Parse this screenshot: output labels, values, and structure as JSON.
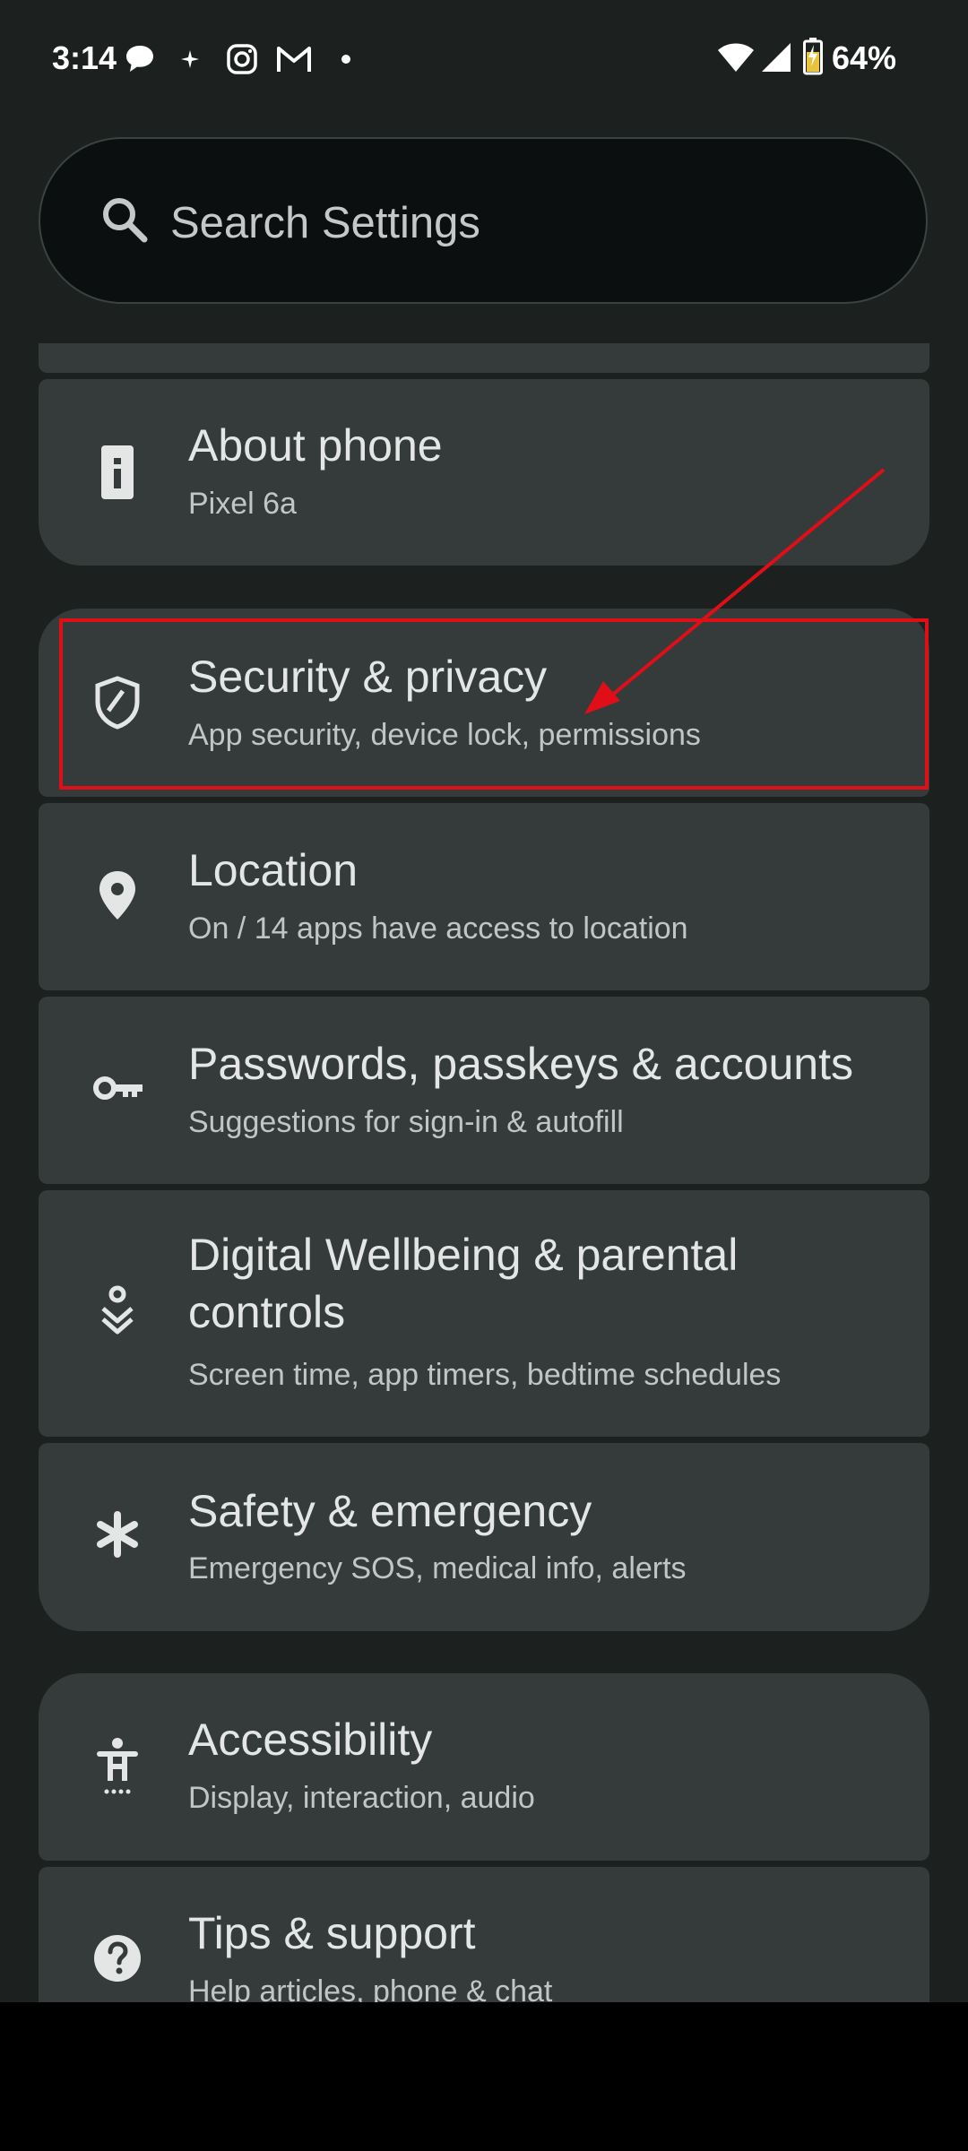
{
  "status_bar": {
    "time": "3:14",
    "battery": "64%",
    "notification_icons": [
      "chat-bubble-icon",
      "sparkle-icon",
      "instagram-icon",
      "gmail-icon",
      "dot-icon"
    ],
    "system_icons": [
      "wifi-icon",
      "signal-icon",
      "battery-icon"
    ]
  },
  "search": {
    "placeholder": "Search Settings",
    "icon": "search-icon"
  },
  "settings_items": [
    {
      "title": "About phone",
      "subtitle": "Pixel 6a",
      "icon": "info-icon"
    },
    {
      "title": "Security & privacy",
      "subtitle": "App security, device lock, permissions",
      "icon": "shield-icon"
    },
    {
      "title": "Location",
      "subtitle": "On / 14 apps have access to location",
      "icon": "location-pin-icon"
    },
    {
      "title": "Passwords, passkeys & accounts",
      "subtitle": "Suggestions for sign-in & autofill",
      "icon": "key-icon"
    },
    {
      "title": "Digital Wellbeing & parental controls",
      "subtitle": "Screen time, app timers, bedtime schedules",
      "icon": "wellbeing-icon"
    },
    {
      "title": "Safety & emergency",
      "subtitle": "Emergency SOS, medical info, alerts",
      "icon": "asterisk-icon"
    },
    {
      "title": "Accessibility",
      "subtitle": "Display, interaction, audio",
      "icon": "accessibility-icon"
    },
    {
      "title": "Tips & support",
      "subtitle": "Help articles, phone & chat",
      "icon": "help-icon"
    }
  ],
  "annotation": {
    "highlight_color": "#e00e17"
  },
  "colors": {
    "background": "#1c2120",
    "card": "#353b3a",
    "search_bg": "#0b0f0f"
  }
}
